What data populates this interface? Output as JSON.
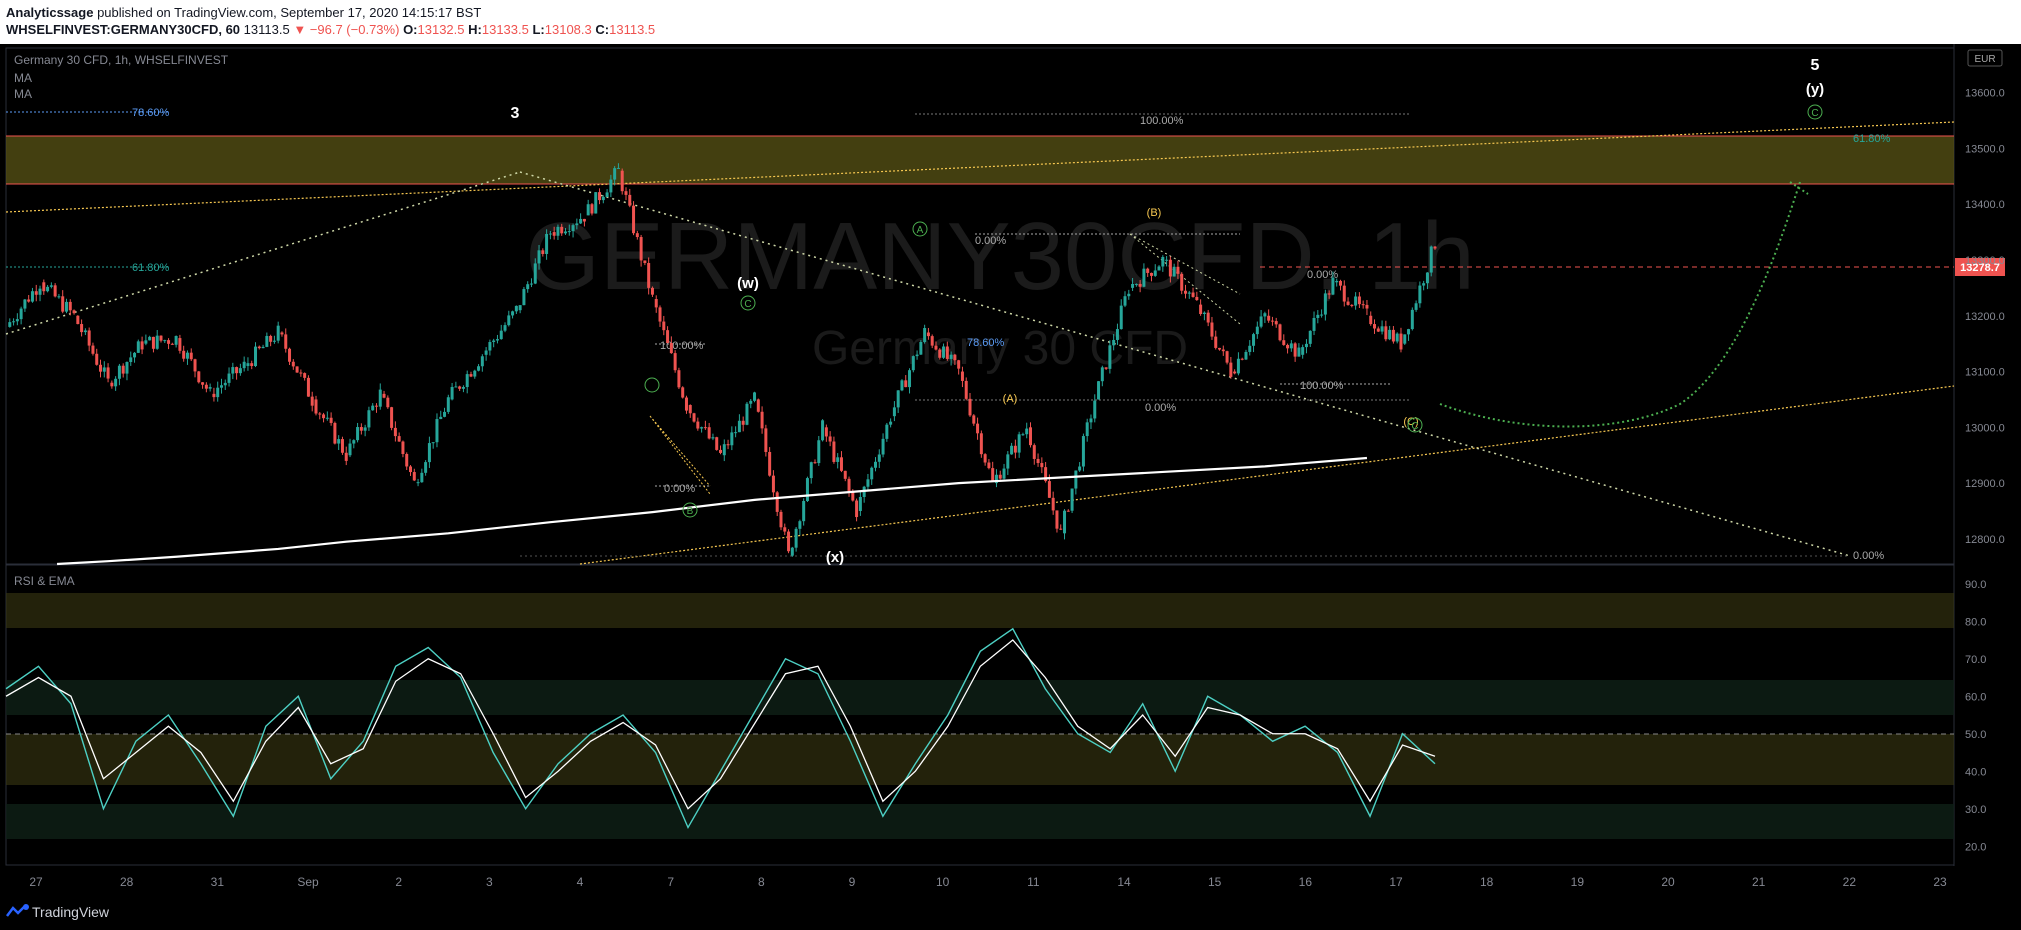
{
  "header": {
    "publisher": "Analyticssage",
    "published_text": "published on TradingView.com, September 17, 2020 14:15:17 BST",
    "symbol": "WHSELFINVEST:GERMANY30CFD, 60",
    "price": "13113.5",
    "change": "▼ −96.7 (−0.73%)",
    "o_label": "O:",
    "o": "13132.5",
    "h_label": "H:",
    "h": "13133.5",
    "l_label": "L:",
    "l": "13108.3",
    "c_label": "C:",
    "c": "13113.5"
  },
  "legend": {
    "title": "Germany 30 CFD, 1h, WHSELFINVEST",
    "ma1": "MA",
    "ma2": "MA",
    "rsi_title": "RSI & EMA",
    "currency": "EUR"
  },
  "watermark": {
    "big": "GERMANY30CFD, 1h",
    "small": "Germany 30 CFD"
  },
  "price_badge": "13278.7",
  "footer": {
    "brand": "TradingView"
  },
  "colors": {
    "up": "#26a69a",
    "down": "#ef5350",
    "fib": "#5b9cf6",
    "orange": "#f7c851",
    "green_wave": "#4caf50",
    "zone": "#5a5416"
  },
  "chart_data": [
    {
      "type": "line",
      "title": "Germany 30 CFD, 1h, WHSELFINVEST",
      "x_ticks": [
        "27",
        "28",
        "31",
        "Sep",
        "2",
        "3",
        "4",
        "7",
        "8",
        "9",
        "10",
        "11",
        "14",
        "15",
        "16",
        "17",
        "18",
        "19",
        "20",
        "21",
        "22",
        "23"
      ],
      "y_ticks": [
        "13600.0",
        "13500.0",
        "13400.0",
        "13300.0",
        "13200.0",
        "13100.0",
        "13000.0",
        "12900.0",
        "12800.0"
      ],
      "ylim": [
        12755,
        13680
      ],
      "price_path": {
        "x": [
          0,
          1,
          2,
          3,
          4,
          5,
          6,
          7,
          8,
          9,
          10,
          11,
          12,
          13,
          14,
          15,
          16,
          17,
          18,
          19,
          20,
          21,
          22,
          23,
          24,
          25,
          26,
          27,
          28,
          29,
          30,
          31,
          32,
          33,
          34,
          35,
          36,
          37,
          38,
          39,
          40,
          41,
          42
        ],
        "y": [
          13180,
          13260,
          13200,
          13080,
          13150,
          13160,
          13060,
          13110,
          13170,
          13050,
          12950,
          13060,
          12900,
          13050,
          13130,
          13210,
          13350,
          13380,
          13460,
          13230,
          13040,
          12950,
          13050,
          12770,
          13000,
          12850,
          13020,
          13170,
          13100,
          12900,
          13000,
          12810,
          13050,
          13250,
          13300,
          13220,
          13100,
          13200,
          13130,
          13260,
          13200,
          13150,
          13330
        ]
      },
      "ma_line": {
        "x": [
          1.5,
          3,
          5,
          8,
          10,
          13,
          16,
          19,
          22,
          25,
          28,
          31,
          34,
          37,
          40
        ],
        "y": [
          12755,
          12760,
          12768,
          12782,
          12795,
          12810,
          12830,
          12848,
          12870,
          12885,
          12900,
          12910,
          12920,
          12930,
          12945
        ]
      },
      "wave_labels": [
        "3",
        "(w)",
        "(x)",
        "5",
        "(y)",
        "(B)",
        "(A)",
        "(C)",
        "A",
        "B",
        "C",
        "C",
        "C"
      ],
      "fib_labels": [
        "78.60%",
        "61.80%",
        "100.00%",
        "0.00%",
        "100.00%",
        "78.60%",
        "0.00%",
        "100.00%",
        "0.00%",
        "0.00%",
        "0.00%",
        "0.00%",
        "61.80%"
      ]
    },
    {
      "type": "line",
      "title": "RSI & EMA",
      "y_ticks": [
        "90.0",
        "80.0",
        "70.0",
        "60.0",
        "50.0",
        "40.0",
        "30.0",
        "20.0"
      ],
      "ylim": [
        15,
        95
      ],
      "rsi": [
        62,
        68,
        58,
        30,
        48,
        55,
        42,
        28,
        52,
        60,
        38,
        48,
        68,
        73,
        65,
        45,
        30,
        42,
        50,
        55,
        45,
        25,
        40,
        55,
        70,
        66,
        48,
        28,
        42,
        55,
        72,
        78,
        62,
        50,
        45,
        58,
        40,
        60,
        55,
        48,
        52,
        45,
        28,
        50,
        42
      ],
      "ema": [
        60,
        65,
        60,
        38,
        45,
        52,
        45,
        32,
        48,
        57,
        42,
        46,
        64,
        70,
        66,
        50,
        33,
        40,
        48,
        53,
        47,
        30,
        38,
        52,
        66,
        68,
        52,
        32,
        40,
        52,
        68,
        75,
        65,
        52,
        46,
        55,
        44,
        57,
        55,
        50,
        50,
        46,
        32,
        47,
        44
      ]
    }
  ]
}
